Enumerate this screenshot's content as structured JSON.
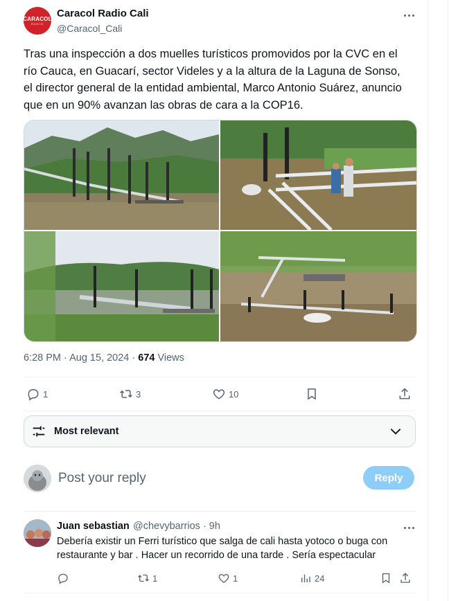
{
  "tweet": {
    "author_name": "Caracol Radio Cali",
    "author_handle": "@Caracol_Cali",
    "avatar_text_main": "CARACOL",
    "avatar_text_sub": "RADIO",
    "text": "Tras una inspección a dos muelles turísticos promovidos por la CVC en el río Cauca, en Guacarí, sector Videles y a la altura de la Laguna de Sonso, el director general de la entidad ambiental, Marco Antonio Suárez, anuncio que en un 90% avanzan las obras de cara a la COP16.",
    "timestamp": "6:28 PM · Aug 15, 2024 · ",
    "views_count": "674",
    "views_label": " Views",
    "replies": "1",
    "reposts": "3",
    "likes": "10"
  },
  "sort": {
    "label": "Most relevant"
  },
  "reply_box": {
    "placeholder": "Post your reply",
    "button": "Reply"
  },
  "comment": {
    "author_name": "Juan sebastian",
    "author_handle": "@chevybarrios · 9h",
    "text": "Debería existir un Ferri turístico que salga de cali hasta yotoco o buga con restaurante y bar . Hacer un recorrido de una tarde . Sería espectacular",
    "replies": "",
    "reposts": "1",
    "likes": "1",
    "views": "24"
  },
  "colors": {
    "accent": "#1d9bf0",
    "reply_button": "#8ecdf8",
    "muted": "#536471",
    "brand_red": "#d1222a"
  },
  "icons": [
    "more-icon",
    "reply-icon",
    "repost-icon",
    "like-icon",
    "bookmark-icon",
    "share-icon",
    "filter-icon",
    "chevron-down-icon",
    "views-icon"
  ]
}
